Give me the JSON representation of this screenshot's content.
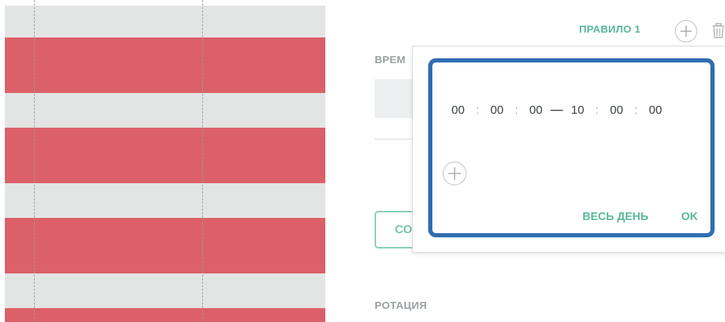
{
  "rule": {
    "label": "ПРАВИЛО 1",
    "add_icon": "plus-circle-icon",
    "delete_icon": "trash-icon"
  },
  "time_section": {
    "label": "ВРЕМ"
  },
  "save_button": {
    "label": "СО"
  },
  "rotation_section": {
    "label": "РОТАЦИЯ"
  },
  "time_popup": {
    "range": {
      "start_h": "00",
      "start_m": "00",
      "start_s": "00",
      "end_h": "10",
      "end_m": "00",
      "end_s": "00"
    },
    "separator": ":",
    "add_icon": "plus-circle-icon",
    "all_day_label": "ВЕСЬ ДЕНЬ",
    "ok_label": "OK"
  },
  "colors": {
    "accent": "#5ab89a",
    "busy_row": "#dc6068",
    "free_row": "#e3e5e4",
    "highlight": "#2f6db0"
  }
}
